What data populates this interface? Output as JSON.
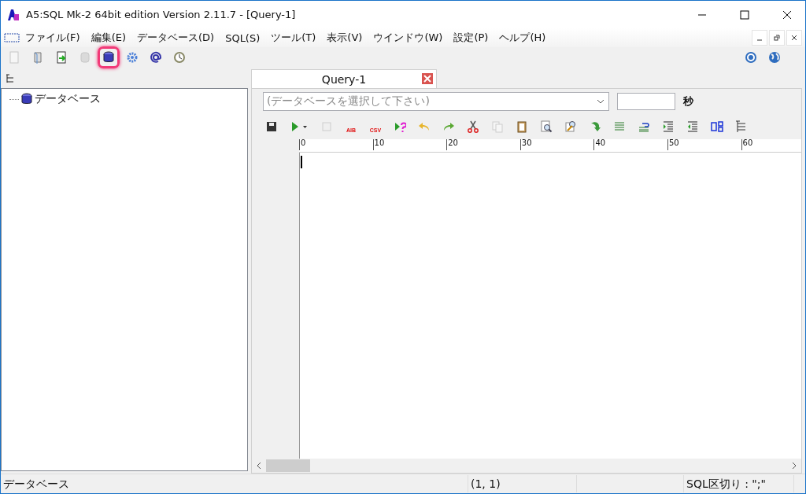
{
  "window": {
    "title": "A5:SQL Mk-2 64bit edition Version 2.11.7 - [Query-1]"
  },
  "menu": [
    "ファイル(F)",
    "編集(E)",
    "データベース(D)",
    "SQL(S)",
    "ツール(T)",
    "表示(V)",
    "ウインドウ(W)",
    "設定(P)",
    "ヘルプ(H)"
  ],
  "toolbar": [
    {
      "kind": "page",
      "disabled": true,
      "highlighted": false
    },
    {
      "kind": "book",
      "disabled": false,
      "highlighted": false
    },
    {
      "kind": "export",
      "disabled": false,
      "highlighted": false
    },
    {
      "kind": "dbcopy",
      "disabled": true,
      "highlighted": false
    },
    {
      "kind": "database",
      "disabled": false,
      "highlighted": true
    },
    {
      "kind": "gear",
      "disabled": false,
      "highlighted": false
    },
    {
      "kind": "at",
      "disabled": false,
      "highlighted": false
    },
    {
      "kind": "clock",
      "disabled": false,
      "highlighted": false
    }
  ],
  "tree": {
    "items": [
      {
        "label": "データベース"
      }
    ]
  },
  "tabs": [
    {
      "label": "Query-1",
      "selected": true
    }
  ],
  "database_select": {
    "placeholder": "(データベースを選択して下さい)"
  },
  "timeout_unit": "秒",
  "editor_toolbar": [
    {
      "kind": "save",
      "disabled": false
    },
    {
      "kind": "run",
      "disabled": false
    },
    {
      "kind": "stop",
      "disabled": true
    },
    {
      "kind": "runtext",
      "label": "AIB",
      "disabled": false
    },
    {
      "kind": "runtext",
      "label": "CSV",
      "disabled": false
    },
    {
      "kind": "explain",
      "disabled": false
    },
    {
      "kind": "undo",
      "disabled": false
    },
    {
      "kind": "redo",
      "disabled": false
    },
    {
      "kind": "cut",
      "disabled": false
    },
    {
      "kind": "copy",
      "disabled": true
    },
    {
      "kind": "paste",
      "disabled": false
    },
    {
      "kind": "find",
      "disabled": false
    },
    {
      "kind": "replace",
      "disabled": false
    },
    {
      "kind": "jump",
      "disabled": false
    },
    {
      "kind": "align",
      "disabled": false
    },
    {
      "kind": "wrap",
      "disabled": false
    },
    {
      "kind": "indent",
      "disabled": false
    },
    {
      "kind": "outdent",
      "disabled": false
    },
    {
      "kind": "blocks",
      "disabled": false
    },
    {
      "kind": "outline",
      "disabled": false
    }
  ],
  "ruler": [
    "0",
    "10",
    "20",
    "30",
    "40",
    "50",
    "60"
  ],
  "status_bar": [
    "データベース",
    "(1, 1)",
    "SQL区切り : \";\""
  ]
}
